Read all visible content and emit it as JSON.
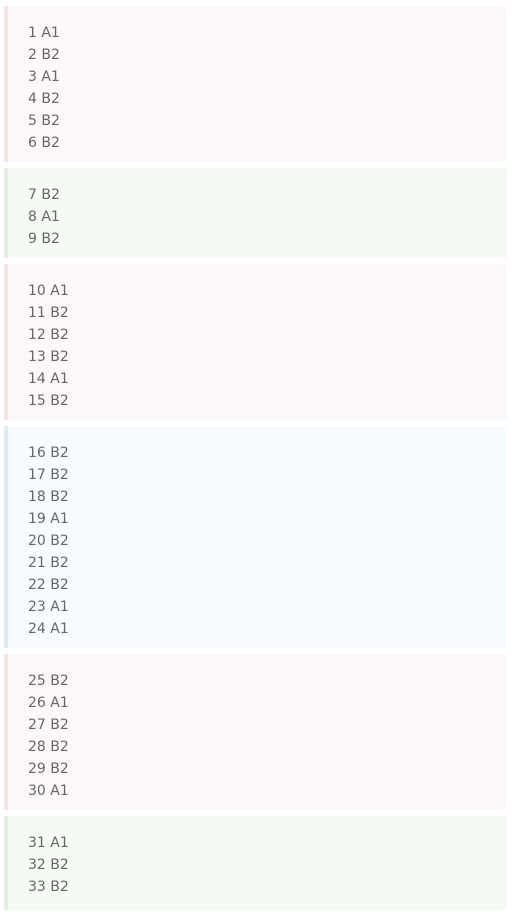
{
  "blocks": [
    {
      "theme": "red",
      "lines": [
        "1 A1",
        "2 B2",
        "3 A1",
        "4 B2",
        "5 B2",
        "6 B2"
      ]
    },
    {
      "theme": "green",
      "lines": [
        "7 B2",
        "8 A1",
        "9 B2"
      ]
    },
    {
      "theme": "red",
      "lines": [
        "10 A1",
        "11 B2",
        "12 B2",
        "13 B2",
        "14 A1",
        "15 B2"
      ]
    },
    {
      "theme": "blue",
      "lines": [
        "16 B2",
        "17 B2",
        "18 B2",
        "19 A1",
        "20 B2",
        "21 B2",
        "22 B2",
        "23 A1",
        "24 A1"
      ]
    },
    {
      "theme": "red",
      "lines": [
        "25 B2",
        "26 A1",
        "27 B2",
        "28 B2",
        "29 B2",
        "30 A1"
      ]
    },
    {
      "theme": "green",
      "lines": [
        "31 A1",
        "32 B2",
        "33 B2"
      ]
    }
  ]
}
